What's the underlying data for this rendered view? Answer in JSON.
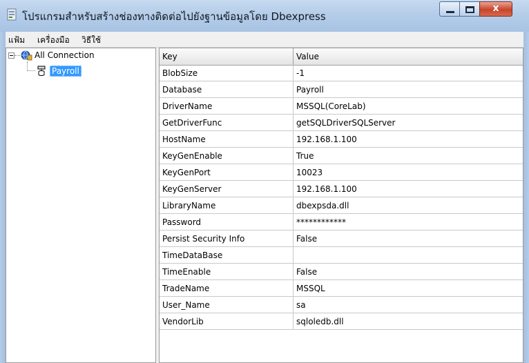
{
  "window": {
    "title": "โปรแกรมสำหรับสร้างช่องทางติดต่อไปยังฐานข้อมูลโดย Dbexpress",
    "controls": {
      "minimize": "minimize-icon",
      "maximize": "maximize-icon",
      "close": "x"
    }
  },
  "menu": {
    "items": [
      "แฟ้ม",
      "เครื่องมือ",
      "วิธีใช้"
    ]
  },
  "tree": {
    "root": {
      "label": "All Connection",
      "icon": "database-connection-icon",
      "expanded": true
    },
    "children": [
      {
        "label": "Payroll",
        "icon": "database-icon",
        "selected": true
      }
    ]
  },
  "grid": {
    "columns": [
      "Key",
      "Value"
    ],
    "rows": [
      {
        "key": "BlobSize",
        "value": "-1"
      },
      {
        "key": "Database",
        "value": "Payroll"
      },
      {
        "key": "DriverName",
        "value": "MSSQL(CoreLab)"
      },
      {
        "key": "GetDriverFunc",
        "value": "getSQLDriverSQLServer"
      },
      {
        "key": "HostName",
        "value": "192.168.1.100"
      },
      {
        "key": "KeyGenEnable",
        "value": "True"
      },
      {
        "key": "KeyGenPort",
        "value": "10023"
      },
      {
        "key": "KeyGenServer",
        "value": "192.168.1.100"
      },
      {
        "key": "LibraryName",
        "value": "dbexpsda.dll"
      },
      {
        "key": "Password",
        "value": "************"
      },
      {
        "key": "Persist Security Info",
        "value": "False"
      },
      {
        "key": "TimeDataBase",
        "value": ""
      },
      {
        "key": "TimeEnable",
        "value": "False"
      },
      {
        "key": "TradeName",
        "value": "MSSQL"
      },
      {
        "key": "User_Name",
        "value": "sa"
      },
      {
        "key": "VendorLib",
        "value": "sqloledb.dll"
      }
    ]
  },
  "colors": {
    "selection": "#3399ff",
    "title_bar": "#b5cde9",
    "close_button": "#c7452b"
  }
}
